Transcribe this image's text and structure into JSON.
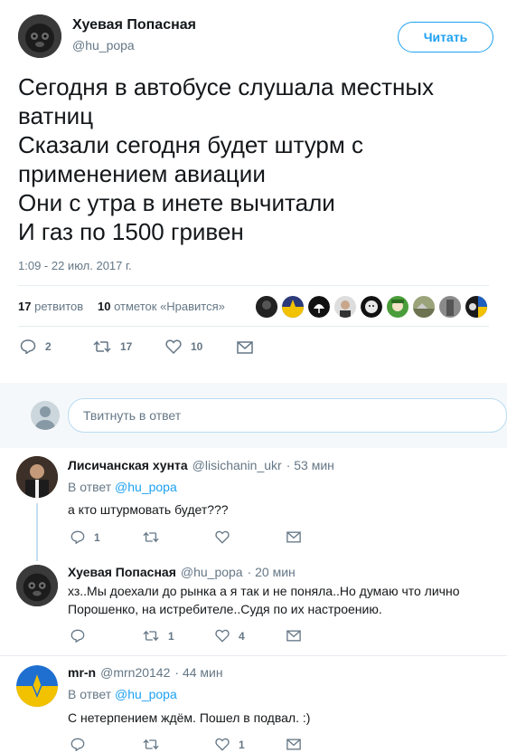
{
  "tweet": {
    "author_name": "Хуевая Попасная",
    "author_handle": "@hu_popa",
    "follow_label": "Читать",
    "lines": [
      "Сегодня в автобусе слушала местных",
      "ватниц",
      "Сказали сегодня будет штурм с",
      "применением авиации",
      "Они с утра в инете вычитали",
      "И газ по 1500 гривен"
    ],
    "timestamp": "1:09 - 22 июл. 2017 г.",
    "retweets_count": "17",
    "retweets_label": "ретвитов",
    "likes_count": "10",
    "likes_label": "отметок «Нравится»",
    "actions": {
      "replies": "2",
      "retweets": "17",
      "likes": "10"
    }
  },
  "reply_box": {
    "placeholder": "Твитнуть в ответ"
  },
  "replies": [
    {
      "name": "Лисичанская хунта",
      "handle": "@lisichanin_ukr",
      "time": "· 53 мин",
      "in_reply_prefix": "В ответ",
      "in_reply_handle": "@hu_popa",
      "text": "а кто штурмовать будет???",
      "actions": {
        "replies": "1",
        "retweets": "",
        "likes": ""
      }
    },
    {
      "name": "Хуевая Попасная",
      "handle": "@hu_popa",
      "time": "· 20 мин",
      "text": "хз..Мы доехали до рынка а я так и не поняла..Но думаю что лично Порошенко, на истребителе..Судя по их настроению.",
      "actions": {
        "replies": "",
        "retweets": "1",
        "likes": "4"
      }
    },
    {
      "name": "mr-n",
      "handle": "@mrn20142",
      "time": "· 44 мин",
      "in_reply_prefix": "В ответ",
      "in_reply_handle": "@hu_popa",
      "text": "С нетерпением ждём. Пошел в подвал. :)",
      "actions": {
        "replies": "",
        "retweets": "",
        "likes": "1"
      }
    }
  ],
  "icons": [
    "reply-icon",
    "retweet-icon",
    "like-icon",
    "message-icon"
  ],
  "colors": {
    "accent": "#1da1f2",
    "text": "#14171a",
    "muted": "#657786",
    "divider": "#e6ecf0"
  }
}
